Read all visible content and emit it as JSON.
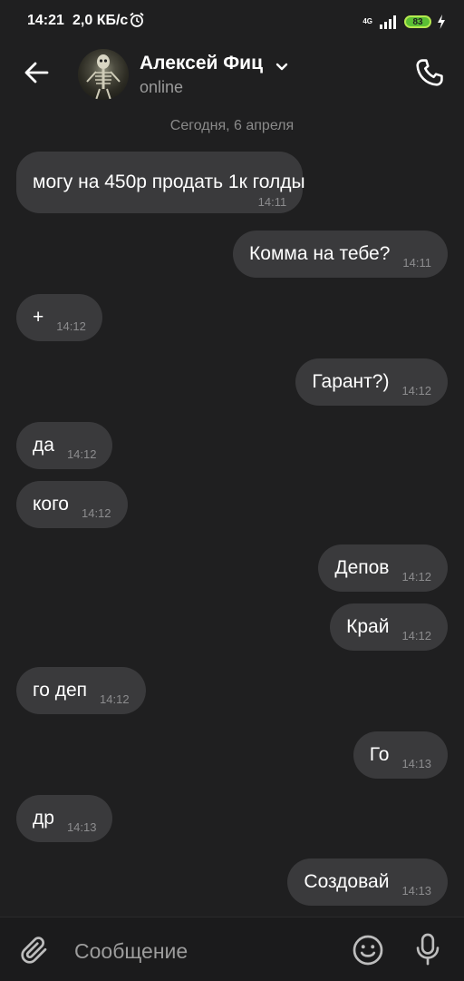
{
  "status_bar": {
    "time": "14:21",
    "speed": "2,0 КБ/с",
    "network": "4G",
    "battery": "83",
    "icons": [
      "alarm-icon",
      "signal-icon",
      "battery-icon",
      "charging-icon"
    ]
  },
  "header": {
    "contact_name": "Алексей Фиц",
    "status": "online",
    "icons": [
      "back-arrow-icon",
      "chevron-down-icon",
      "phone-icon"
    ]
  },
  "date_separator": "Сегодня, 6 апреля",
  "messages": [
    {
      "direction": "in",
      "text": "могу на 450р продать 1к голды",
      "time": "14:11"
    },
    {
      "direction": "out",
      "text": "Комма на тебе?",
      "time": "14:11"
    },
    {
      "direction": "in",
      "text": "+",
      "time": "14:12"
    },
    {
      "direction": "out",
      "text": "Гарант?)",
      "time": "14:12"
    },
    {
      "direction": "in",
      "text": "да",
      "time": "14:12"
    },
    {
      "direction": "in",
      "text": "кого",
      "time": "14:12"
    },
    {
      "direction": "out",
      "text": "Депов",
      "time": "14:12"
    },
    {
      "direction": "out",
      "text": "Край",
      "time": "14:12"
    },
    {
      "direction": "in",
      "text": "го деп",
      "time": "14:12"
    },
    {
      "direction": "out",
      "text": "Го",
      "time": "14:13"
    },
    {
      "direction": "in",
      "text": "др",
      "time": "14:13"
    },
    {
      "direction": "out",
      "text": "Создовай",
      "time": "14:13"
    }
  ],
  "composer": {
    "placeholder": "Сообщение",
    "value": "",
    "icons": [
      "attach-icon",
      "emoji-icon",
      "microphone-icon"
    ]
  },
  "colors": {
    "background": "#1f1f20",
    "bubble": "#3a3a3c",
    "secondary_text": "#9a9a9a",
    "battery": "#5bbf34"
  }
}
